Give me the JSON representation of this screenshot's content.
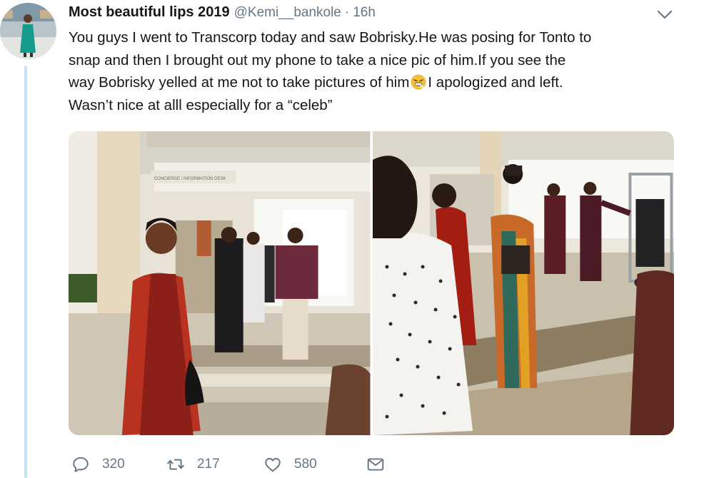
{
  "tweet": {
    "display_name": "Most beautiful lips 2019",
    "handle": "@Kemi__bankole",
    "separator": "·",
    "time": "16h",
    "lines": [
      "You guys I went to Transcorp today and saw Bobrisky.He was posing for Tonto to",
      "snap and then I brought out my phone to take a nice pic of him.If you see the",
      "way Bobrisky yelled at me not to take pictures of him",
      "I apologized and left.",
      "Wasn’t nice at alll especially for a “celeb”"
    ],
    "emoji": "grimacing-sneeze-face-emoji",
    "sign_left": "CONCIERGE / INFORMATION DESK"
  },
  "actions": {
    "reply_count": "320",
    "retweet_count": "217",
    "like_count": "580"
  },
  "colors": {
    "text": "#14171a",
    "secondary": "#657786",
    "thread_line": "#c4e4f6"
  },
  "icons": [
    "chevron-down-icon",
    "reply-icon",
    "retweet-icon",
    "like-icon",
    "direct-message-icon"
  ]
}
